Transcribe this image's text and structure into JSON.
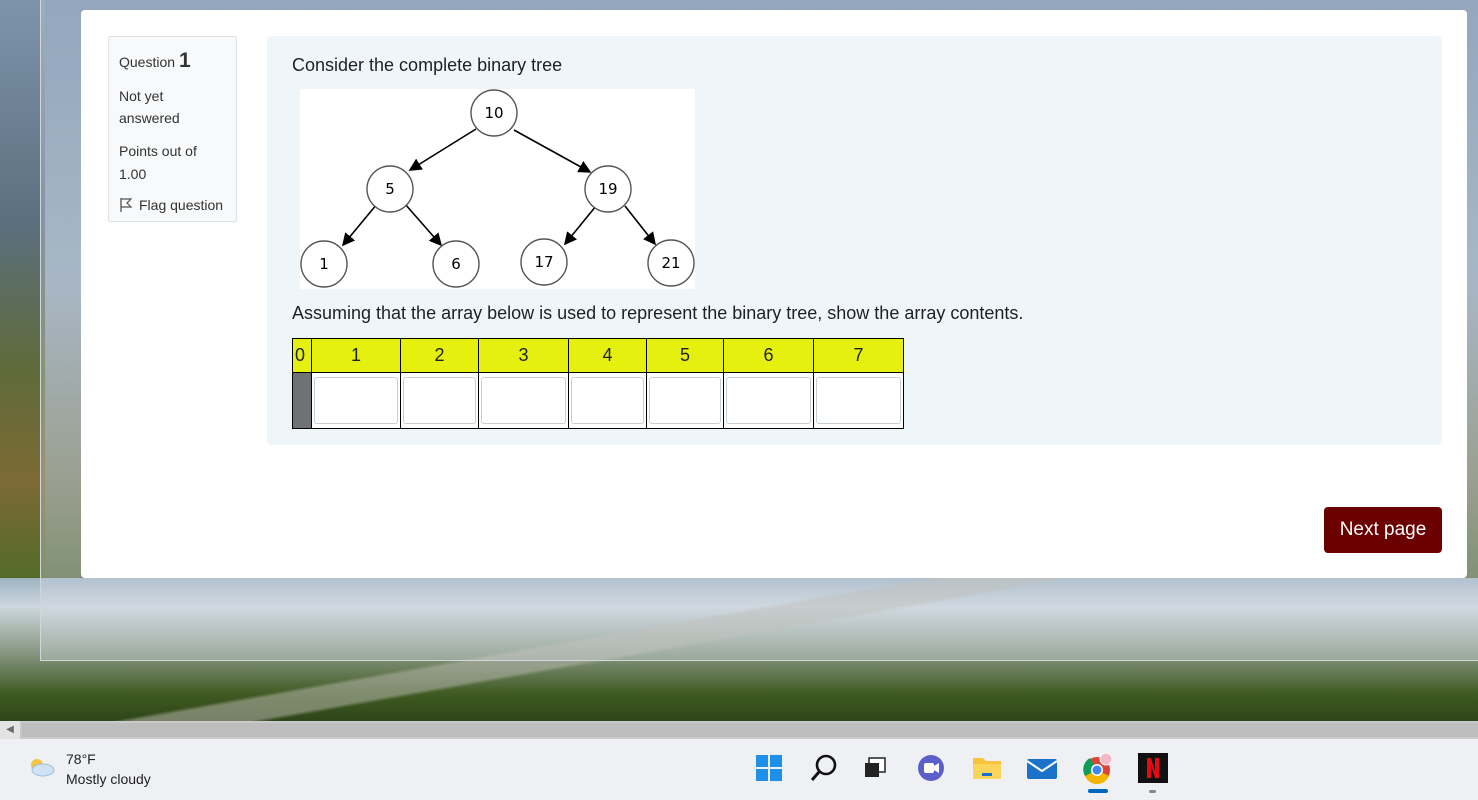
{
  "question_info": {
    "label": "Question",
    "number": "1",
    "state_line1": "Not yet",
    "state_line2": "answered",
    "grade_line1": "Points out of",
    "grade_line2": "1.00",
    "flag_label": "Flag question"
  },
  "question": {
    "text1": "Consider the complete binary tree",
    "text2": "Assuming that the array below is used to represent the binary tree, show the array contents."
  },
  "tree_nodes": [
    "10",
    "5",
    "19",
    "1",
    "6",
    "17",
    "21"
  ],
  "array_table": {
    "headers": [
      "0",
      "1",
      "2",
      "3",
      "4",
      "5",
      "6",
      "7"
    ],
    "values": [
      "",
      "",
      "",
      "",
      "",
      "",
      ""
    ]
  },
  "navigation": {
    "next_label": "Next page"
  },
  "weather": {
    "temp": "78°F",
    "condition": "Mostly cloudy"
  },
  "taskbar_icons": [
    "windows-start-icon",
    "search-icon",
    "task-view-icon",
    "chat-icon",
    "file-explorer-icon",
    "mail-icon",
    "chrome-icon",
    "netflix-icon"
  ],
  "colors": {
    "header_yellow": "#e5f00f",
    "next_button": "#6b0000",
    "formulation_bg": "#eef6f9"
  }
}
